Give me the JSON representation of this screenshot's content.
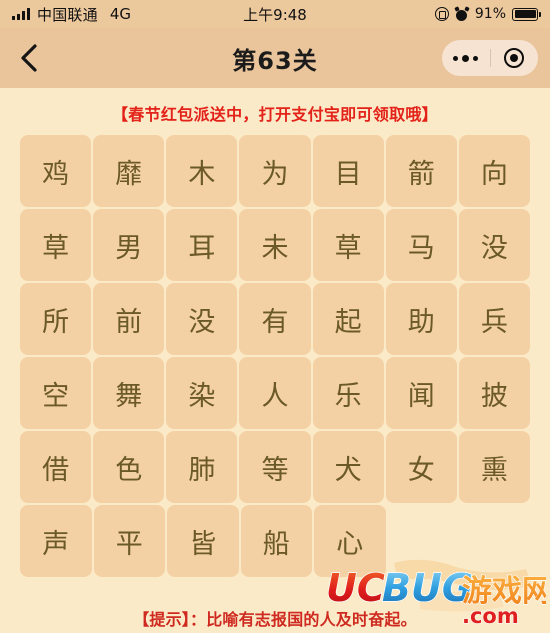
{
  "status_bar": {
    "carrier": "中国联通",
    "network": "4G",
    "time": "上午9:48",
    "battery_percent": "91%",
    "icons": [
      "signal-bars-icon",
      "rotation-lock-icon",
      "alarm-clock-icon",
      "battery-icon"
    ]
  },
  "nav_bar": {
    "back_icon": "chevron-left-icon",
    "title": "第63关",
    "capsule": {
      "more_icon": "ellipsis-icon",
      "target_icon": "target-circle-icon"
    }
  },
  "content": {
    "promo_banner": "【春节红包派送中，打开支付宝即可领取哦】",
    "hint": "【提示】：比喻有志报国的人及时奋起。"
  },
  "grid": {
    "columns": 7,
    "rows": [
      [
        "鸡",
        "靡",
        "木",
        "为",
        "目",
        "箭",
        "向"
      ],
      [
        "草",
        "男",
        "耳",
        "未",
        "草",
        "马",
        "没"
      ],
      [
        "所",
        "前",
        "没",
        "有",
        "起",
        "助",
        "兵"
      ],
      [
        "空",
        "舞",
        "染",
        "人",
        "乐",
        "闻",
        "披"
      ],
      [
        "借",
        "色",
        "肺",
        "等",
        "犬",
        "女",
        "熏"
      ],
      [
        "声",
        "平",
        "皆",
        "船",
        "心"
      ]
    ]
  },
  "watermark": {
    "text_uc": "UC",
    "text_bug": "BUG",
    "text_cn": "游戏网",
    "text_domain": ".com",
    "color_uc": "#e02020",
    "color_bug": "#2f9fe0",
    "color_cn": "#f08a20",
    "color_domain": "#e02020"
  },
  "colors": {
    "status_bar_bg": "#ecc89d",
    "nav_bar_bg": "#eac59b",
    "content_bg": "#fbeac8",
    "tile_bg": "#f4d1a4",
    "tile_text": "#6b5a28",
    "promo_red": "#e32219",
    "hint_red": "#cf2a20"
  }
}
